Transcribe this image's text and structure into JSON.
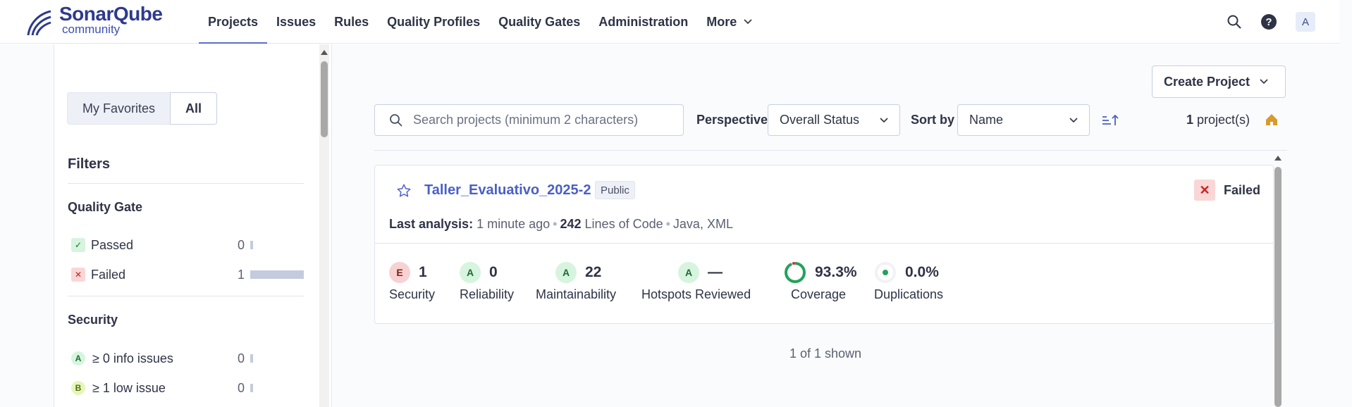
{
  "app": {
    "logo_title": "SonarQube",
    "logo_subtitle": "community"
  },
  "nav": {
    "items": [
      "Projects",
      "Issues",
      "Rules",
      "Quality Profiles",
      "Quality Gates",
      "Administration",
      "More"
    ],
    "active": "Projects",
    "avatar_letter": "A"
  },
  "sidebar": {
    "toggle": [
      "My Favorites",
      "All"
    ],
    "toggle_selected": "All",
    "filters_title": "Filters",
    "quality_gate": {
      "title": "Quality Gate",
      "rows": [
        {
          "label": "Passed",
          "count": "0",
          "fill": 0.05,
          "badge": "✓",
          "color": "#1c6b33",
          "bg": "#d7f4de"
        },
        {
          "label": "Failed",
          "count": "1",
          "fill": 1.0,
          "badge": "✕",
          "color": "#c22222",
          "bg": "#f9d7d7"
        }
      ]
    },
    "security": {
      "title": "Security",
      "rows": [
        {
          "rating": "A",
          "label": "≥ 0 info issues",
          "count": "0",
          "fill": 0.05,
          "bg": "#d7f4de",
          "color": "#1c6b33"
        },
        {
          "rating": "B",
          "label": "≥ 1 low issue",
          "count": "0",
          "fill": 0.05,
          "bg": "#e6f6b8",
          "color": "#4f6b10"
        }
      ]
    }
  },
  "toolbar": {
    "create_label": "Create Project",
    "search_placeholder": "Search projects (minimum 2 characters)",
    "perspective_label": "Perspective",
    "perspective_value": "Overall Status",
    "sortby_label": "Sort by",
    "sortby_value": "Name",
    "count_number": "1",
    "count_suffix": " project(s)"
  },
  "project": {
    "name": "Taller_Evaluativo_2025-2",
    "visibility": "Public",
    "status": "Failed",
    "last_analysis_label": "Last analysis:",
    "last_analysis_value": "1 minute ago",
    "loc_value": "242",
    "loc_label": "Lines of Code",
    "languages": "Java, XML",
    "metrics": [
      {
        "rating": "E",
        "value": "1",
        "label": "Security"
      },
      {
        "rating": "A",
        "value": "0",
        "label": "Reliability"
      },
      {
        "rating": "A",
        "value": "22",
        "label": "Maintainability"
      },
      {
        "rating": "A",
        "value": "—",
        "label": "Hotspots Reviewed"
      }
    ],
    "coverage": {
      "value": "93.3%",
      "label": "Coverage",
      "percent": 93.3
    },
    "duplications": {
      "value": "0.0%",
      "label": "Duplications",
      "percent": 0.0
    }
  },
  "footer": {
    "shown": "1 of 1 shown"
  },
  "colors": {
    "accent": "#4a5fc4",
    "brand": "#2d3a8c",
    "failed_bg": "#f9d7d7",
    "coverage_ring": "#22a25a"
  }
}
